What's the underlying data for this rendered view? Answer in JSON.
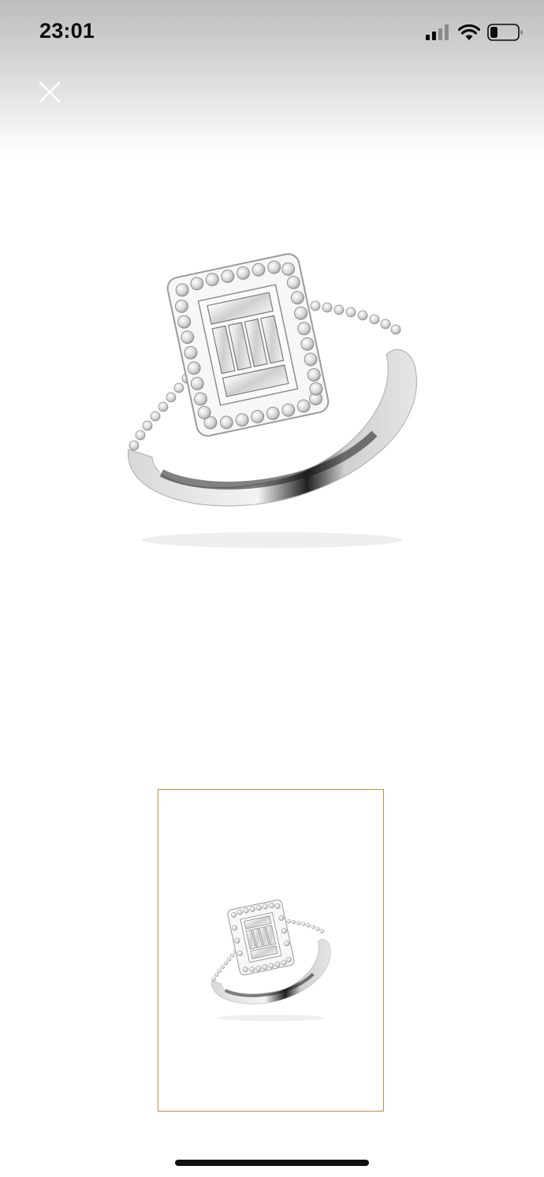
{
  "status_bar": {
    "time": "23:01",
    "icons": [
      "cellular-signal-icon",
      "wifi-icon",
      "battery-icon"
    ],
    "battery_level": 0.25
  },
  "toolbar": {
    "close_icon": "close-icon"
  },
  "gallery": {
    "main_image": "ring-product-image",
    "thumbnails": [
      {
        "icon": "ring-thumbnail-image",
        "selected": true
      }
    ],
    "selected_border_color": "#c98a3f"
  }
}
